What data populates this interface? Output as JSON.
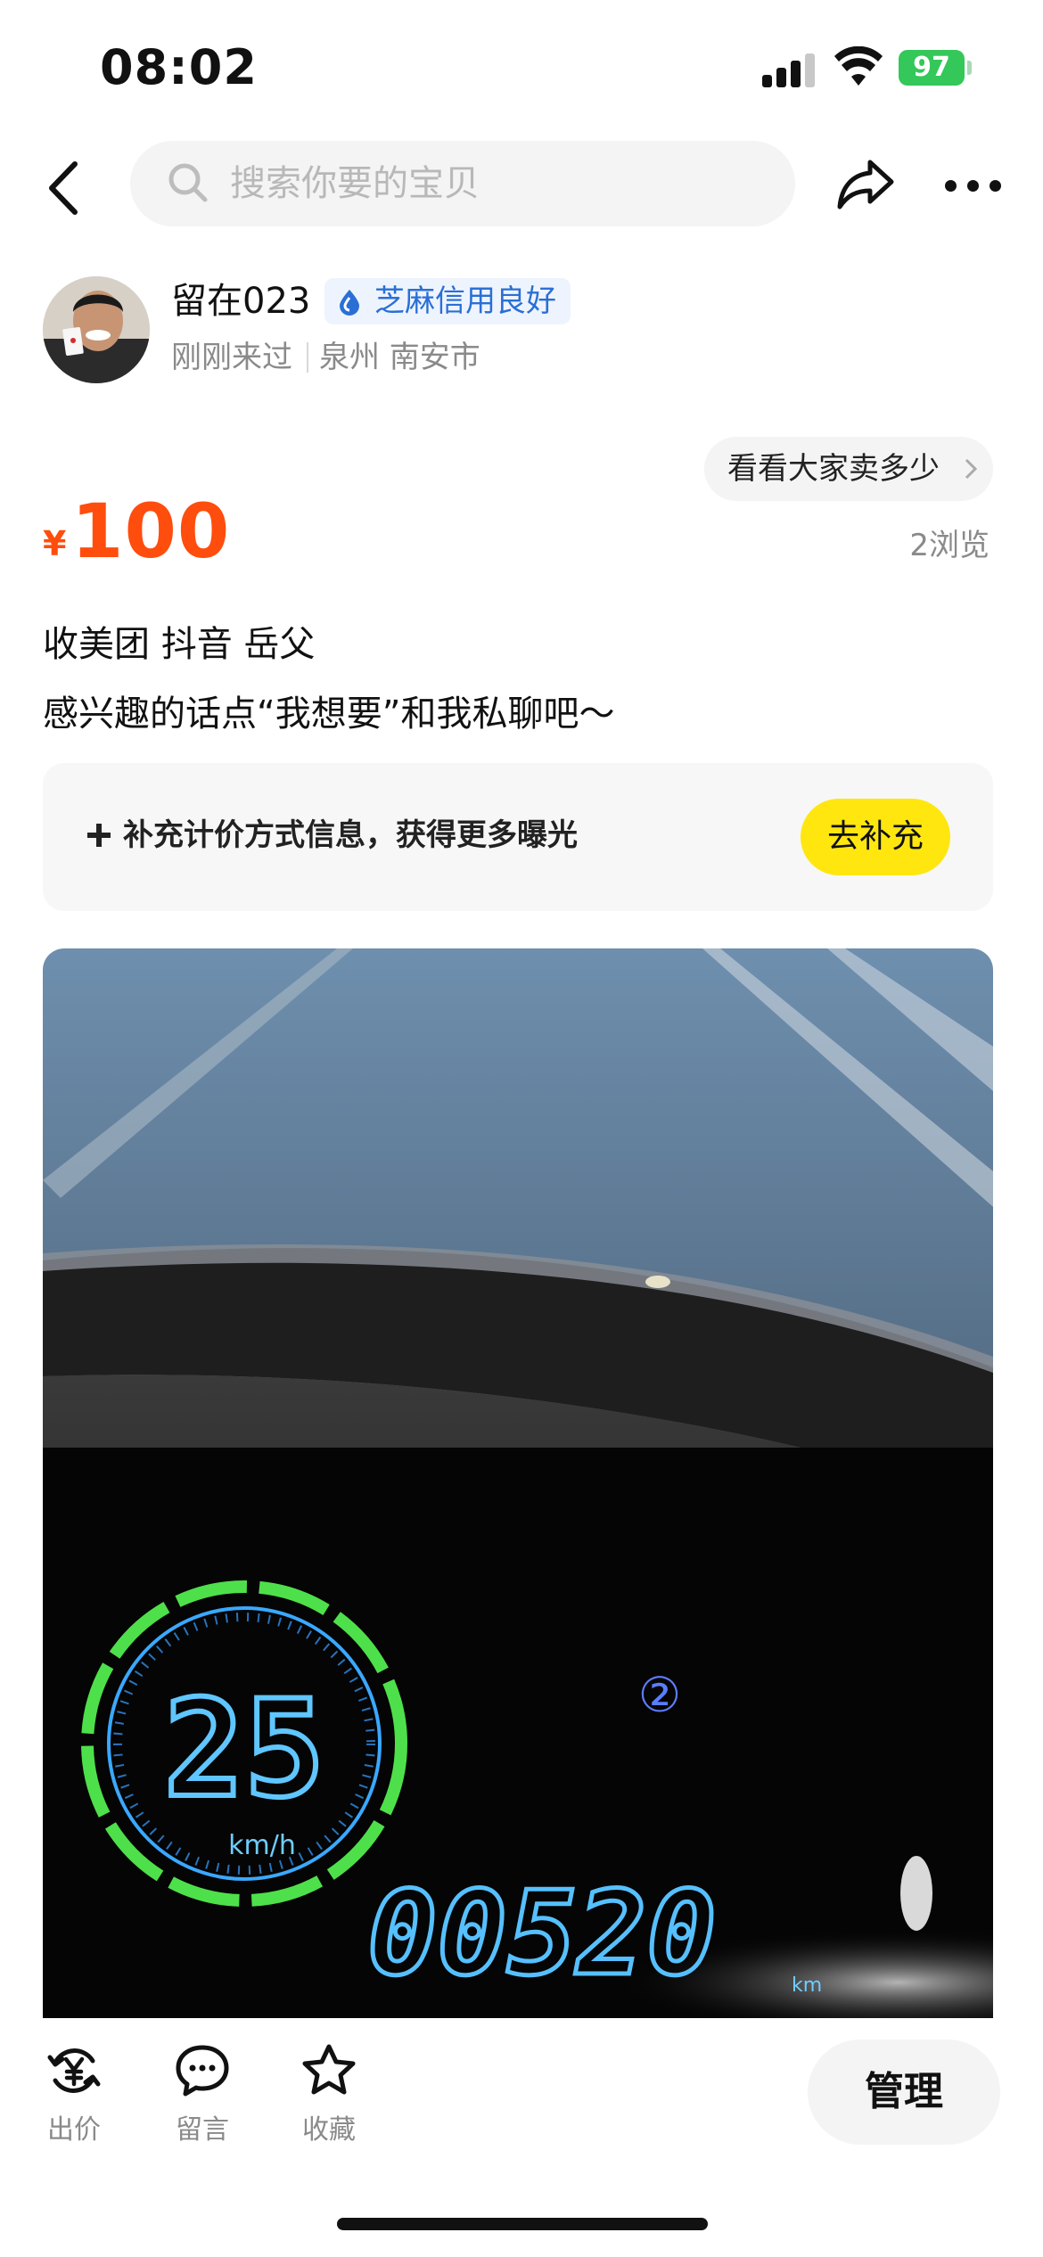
{
  "status_bar": {
    "time": "08:02",
    "battery": "97"
  },
  "nav": {
    "search_placeholder": "搜索你要的宝贝",
    "icons": [
      "back-arrow-icon",
      "search-icon",
      "share-icon",
      "more-icon"
    ]
  },
  "seller": {
    "name": "留在023",
    "credit_badge": "芝麻信用良好",
    "last_seen": "刚刚来过",
    "location": "泉州 南安市"
  },
  "listing": {
    "compare_label": "看看大家卖多少",
    "currency": "¥",
    "price": "100",
    "views": "2浏览",
    "desc_line1": "收美团  抖音  岳父",
    "desc_line2": "感兴趣的话点“我想要”和我私聊吧～"
  },
  "supplement": {
    "text": "补充计价方式信息，获得更多曝光",
    "button": "去补充"
  },
  "photo": {
    "speed": "25",
    "speed_unit": "km/h",
    "gear": "②",
    "odometer": "00520",
    "odo_unit": "km"
  },
  "bottom_bar": {
    "offer_label": "出价",
    "message_label": "留言",
    "favorite_label": "收藏",
    "manage_label": "管理"
  },
  "colors": {
    "price": "#ff4d0d",
    "supplement_button": "#ffe60f",
    "credit_text": "#2a6fd6",
    "battery": "#34c759"
  }
}
